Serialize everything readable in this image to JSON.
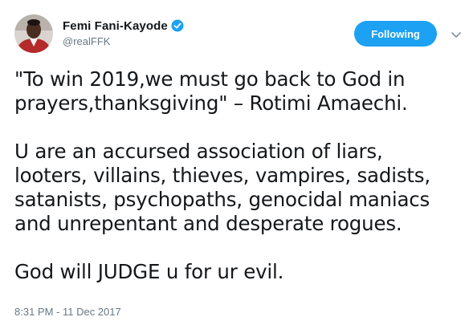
{
  "author": {
    "display_name": "Femi Fani-Kayode",
    "handle": "@realFFK",
    "verified": true,
    "avatar_icon": "profile-photo"
  },
  "follow_button": {
    "label": "Following"
  },
  "menu": {
    "icon": "chevron-down-icon"
  },
  "tweet": {
    "paragraphs": [
      "\"To win 2019,we must go back to God in prayers,thanksgiving\" – Rotimi Amaechi.",
      "U are an accursed association of liars, looters, villains, thieves, vampires, sadists, satanists, psychopaths, genocidal maniacs and unrepentant and desperate rogues.",
      "God will JUDGE u for ur evil."
    ],
    "timestamp": "8:31 PM - 11 Dec 2017"
  },
  "colors": {
    "accent": "#1da1f2",
    "text": "#14171a",
    "secondary_text": "#657786"
  }
}
